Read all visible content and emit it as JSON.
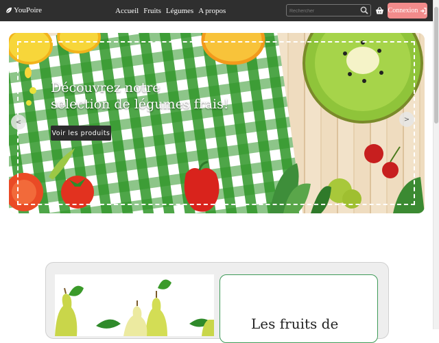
{
  "navbar": {
    "brand": "YouPoire",
    "links": [
      "Accueil",
      "Fruits",
      "Légumes",
      "A propos"
    ],
    "search_placeholder": "Rechercher",
    "login_label": "Connexion"
  },
  "hero": {
    "title_line1": "Découvrez notre",
    "title_line2": "selection de légumes frais!",
    "button_label": "Voir les produits",
    "prev_label": "<",
    "next_label": ">"
  },
  "section": {
    "title": "Les fruits de"
  },
  "icons": {
    "brand": "leaf-icon",
    "search": "search-icon",
    "cart": "basket-icon",
    "login": "sign-in-icon"
  },
  "colors": {
    "navbar_bg": "#2f2f2f",
    "login_button": "#f28b8b",
    "card_border": "#3d9a57",
    "hero_button": "#2c2c2c"
  }
}
